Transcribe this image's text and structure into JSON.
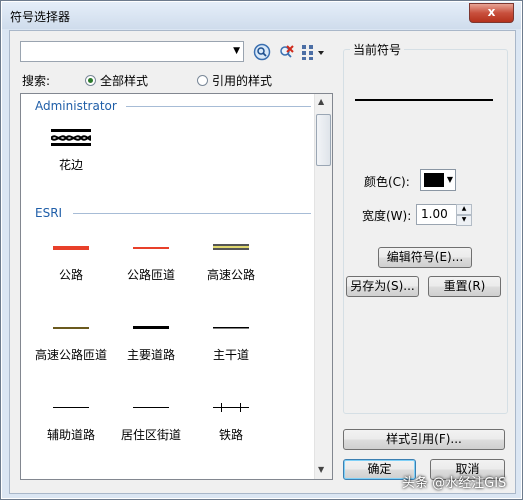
{
  "window": {
    "title": "符号选择器",
    "close_label": "x"
  },
  "combo": {
    "value": ""
  },
  "search": {
    "label": "搜索:",
    "option_all": "全部样式",
    "option_referenced": "引用的样式"
  },
  "list": {
    "groups": [
      {
        "name": "Administrator",
        "items": [
          {
            "label": "花边",
            "icon": "lace-border-symbol"
          }
        ]
      },
      {
        "name": "ESRI",
        "items": [
          {
            "label": "公路",
            "icon": "highway-red-thick"
          },
          {
            "label": "公路匝道",
            "icon": "highway-ramp-red-thin"
          },
          {
            "label": "高速公路",
            "icon": "expressway-double-line"
          },
          {
            "label": "高速公路匝道",
            "icon": "expressway-ramp-olive"
          },
          {
            "label": "主要道路",
            "icon": "major-road-black-thick"
          },
          {
            "label": "主干道",
            "icon": "arterial-black-thin"
          },
          {
            "label": "辅助道路",
            "icon": "secondary-road-black"
          },
          {
            "label": "居住区街道",
            "icon": "residential-street-black"
          },
          {
            "label": "铁路",
            "icon": "railway-ticks"
          }
        ]
      }
    ]
  },
  "current": {
    "title": "当前符号",
    "color_label": "颜色(C):",
    "color_value": "#000000",
    "width_label": "宽度(W):",
    "width_value": "1.00",
    "edit_button": "编辑符号(E)...",
    "save_as_button": "另存为(S)...",
    "reset_button": "重置(R)"
  },
  "footer": {
    "style_ref_button": "样式引用(F)...",
    "ok_button": "确定",
    "cancel_button": "取消"
  },
  "watermark": "头条 @水经注GIS"
}
